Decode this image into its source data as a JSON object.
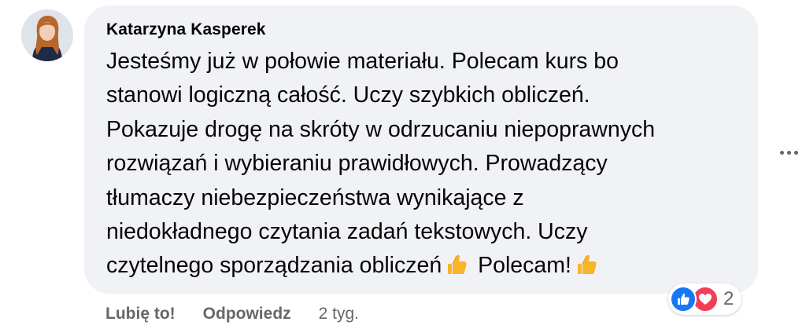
{
  "comment": {
    "author": "Katarzyna Kasperek",
    "body_lines": [
      "Jesteśmy już w połowie materiału. Polecam kurs bo",
      "stanowi logiczną całość. Uczy szybkich obliczeń.",
      "Pokazuje drogę na skróty w odrzucaniu niepoprawnych",
      "rozwiązań i wybieraniu prawidłowych. Prowadzący",
      "tłumaczy niebezpieczeństwa wynikające z",
      "niedokładnego czytania zadań tekstowych. Uczy"
    ],
    "last_line_part1": "czytelnego sporządzania obliczeń",
    "last_line_part2": "Polecam!",
    "emoji": "thumbs-up-emoji"
  },
  "reactions": {
    "count": "2",
    "types": [
      "like-reaction-icon",
      "love-reaction-icon"
    ]
  },
  "actions": {
    "like_label": "Lubię to!",
    "reply_label": "Odpowiedz",
    "timestamp": "2 tyg."
  },
  "colors": {
    "bubble": "#f0f2f5",
    "text": "#050505",
    "secondary": "#65676b",
    "like_blue": "#1877f2",
    "love_red": "#f33e58",
    "emoji_yellow": "#f8b42a"
  }
}
